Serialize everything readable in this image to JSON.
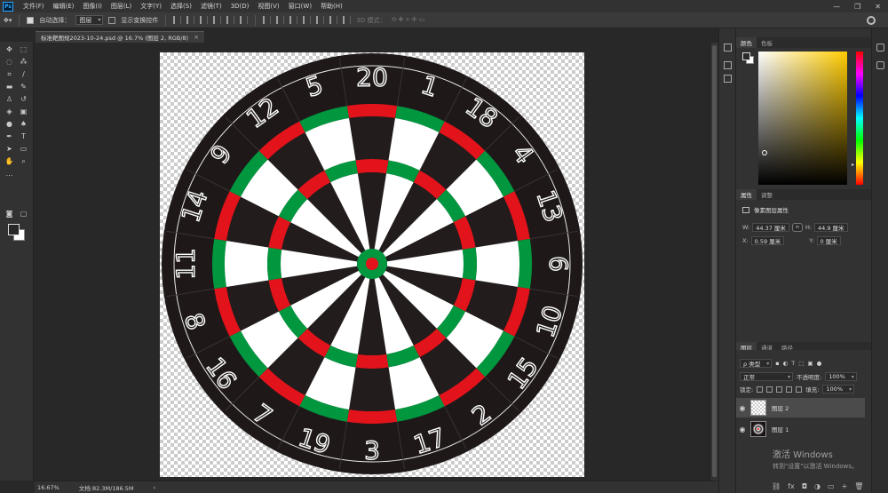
{
  "menubar": {
    "logo": "Ps",
    "items": [
      "文件(F)",
      "编辑(E)",
      "图像(I)",
      "图层(L)",
      "文字(Y)",
      "选择(S)",
      "滤镜(T)",
      "3D(D)",
      "视图(V)",
      "窗口(W)",
      "帮助(H)"
    ],
    "controls": [
      "—",
      "❐",
      "✕"
    ]
  },
  "optionsbar": {
    "auto_select_label": "自动选择：",
    "auto_select_target": "图层",
    "show_transform_label": "显示变换控件",
    "mode_3d_label": "3D 模式："
  },
  "document": {
    "tab_title": "标准靶图规2023-10-24.psd @ 16.7% (图层 2, RGB/8)",
    "close": "×"
  },
  "status": {
    "zoom": "16.67%",
    "doc_size": "文档:82.3M/186.5M"
  },
  "color_panel": {
    "tabs": [
      "颜色",
      "色板"
    ],
    "active_tab": "颜色",
    "accent": "#ffcc00"
  },
  "properties_panel": {
    "tabs": [
      "属性",
      "调整"
    ],
    "active_tab": "属性",
    "title": "像素图层属性",
    "w_label": "W:",
    "w_value": "44.37 厘米",
    "h_label": "H:",
    "h_value": "44.9 厘米",
    "x_label": "X:",
    "x_value": "0.59 厘米",
    "y_label": "Y:",
    "y_value": "0 厘米"
  },
  "layers_panel": {
    "tabs": [
      "图层",
      "通道",
      "路径"
    ],
    "active_tab": "图层",
    "filter_label": "ρ 类型",
    "blend_mode": "正常",
    "opacity_label": "不透明度:",
    "opacity_value": "100%",
    "lock_label": "锁定:",
    "fill_label": "填充:",
    "fill_value": "100%",
    "layers": [
      {
        "name": "图层 2",
        "selected": true
      },
      {
        "name": "图层 1",
        "selected": false
      }
    ],
    "footer_icons": [
      "fx",
      "◘",
      "◑",
      "▭",
      "+",
      "🗑"
    ]
  },
  "watermark": {
    "line1": "激活 Windows",
    "line2": "转到\"设置\"以激活 Windows。"
  },
  "dartboard": {
    "numbers": [
      "20",
      "1",
      "18",
      "4",
      "13",
      "6",
      "10",
      "15",
      "2",
      "17",
      "3",
      "19",
      "7",
      "16",
      "8",
      "11",
      "14",
      "9",
      "12",
      "5"
    ],
    "colors": {
      "black": "#231c1c",
      "white": "#ffffff",
      "red": "#e3131b",
      "green": "#00973f",
      "outer": "#1e1818",
      "wire": "#ffffff"
    }
  }
}
